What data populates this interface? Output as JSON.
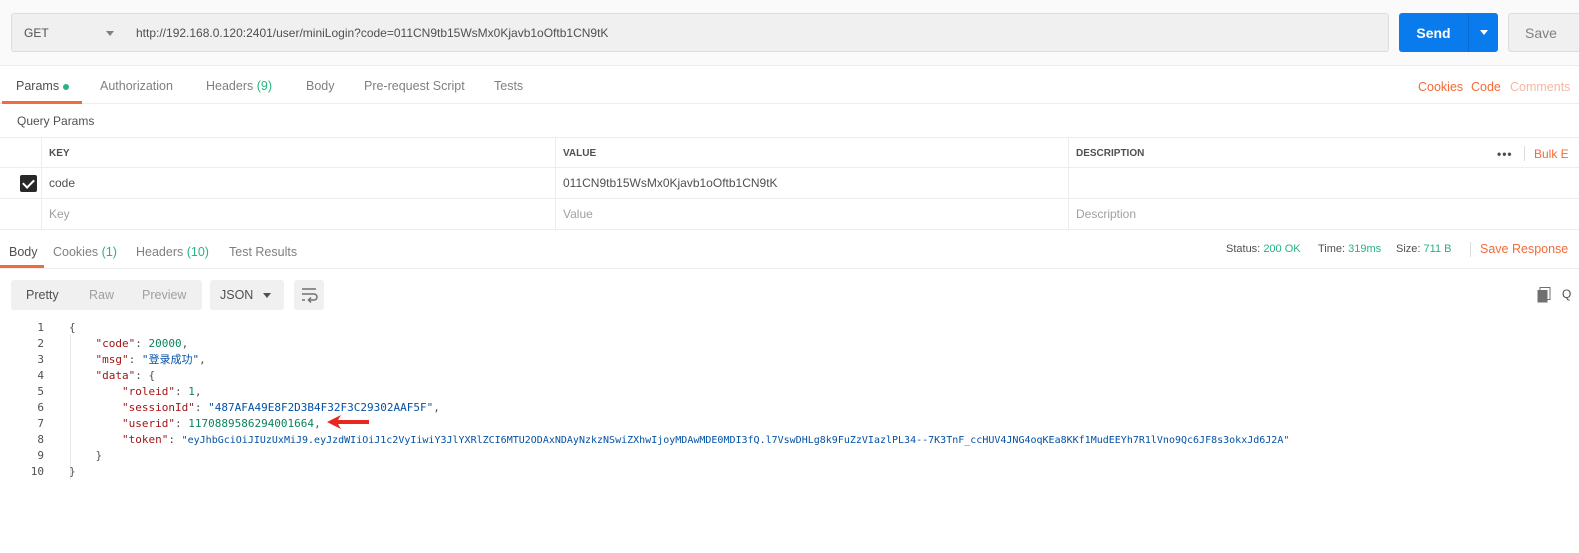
{
  "request": {
    "method": "GET",
    "url": "http://192.168.0.120:2401/user/miniLogin?code=011CN9tb15WsMx0Kjavb1oOftb1CN9tK",
    "send_label": "Send",
    "save_label": "Save"
  },
  "request_tabs": {
    "params": "Params",
    "authorization": "Authorization",
    "headers": "Headers",
    "headers_count": "(9)",
    "body": "Body",
    "prerequest": "Pre-request Script",
    "tests": "Tests"
  },
  "right_links": {
    "cookies": "Cookies",
    "code": "Code",
    "comments": "Comments"
  },
  "query_params": {
    "label": "Query Params",
    "headers": {
      "key": "KEY",
      "value": "VALUE",
      "description": "DESCRIPTION"
    },
    "rows": [
      {
        "key": "code",
        "value": "011CN9tb15WsMx0Kjavb1oOftb1CN9tK",
        "description": ""
      }
    ],
    "placeholders": {
      "key": "Key",
      "value": "Value",
      "description": "Description"
    },
    "bulk_edit": "Bulk E"
  },
  "response_tabs": {
    "body": "Body",
    "cookies": "Cookies",
    "cookies_count": "(1)",
    "headers": "Headers",
    "headers_count": "(10)",
    "test_results": "Test Results"
  },
  "response_status": {
    "status_label": "Status:",
    "status_value": "200 OK",
    "time_label": "Time:",
    "time_value": "319ms",
    "size_label": "Size:",
    "size_value": "711 B",
    "save_response": "Save Response"
  },
  "format": {
    "pretty": "Pretty",
    "raw": "Raw",
    "preview": "Preview",
    "language": "JSON"
  },
  "response_json": {
    "line_numbers": [
      "1",
      "2",
      "3",
      "4",
      "5",
      "6",
      "7",
      "8",
      "9",
      "10"
    ],
    "code_key": "\"code\"",
    "code_value": "20000",
    "msg_key": "\"msg\"",
    "msg_value": "\"登录成功\"",
    "data_key": "\"data\"",
    "roleid_key": "\"roleid\"",
    "roleid_value": "1",
    "sessionid_key": "\"sessionId\"",
    "sessionid_value": "\"487AFA49E8F2D3B4F32F3C29302AAF5F\"",
    "userid_key": "\"userid\"",
    "userid_value": "1170889586294001664",
    "token_key": "\"token\"",
    "token_value": "\"eyJhbGciOiJIUzUxMiJ9.eyJzdWIiOiJ1c2VyIiwiY3JlYXRlZCI6MTU2ODAxNDAyNzkzNSwiZXhwIjoyMDAwMDE0MDI3fQ.l7VswDHLg8k9FuZzVIazlPL34--7K3TnF_ccHUV4JNG4oqKEa8KKf1MudEEYh7R1lVno9Qc6JF8s3okxJd6J2A\""
  },
  "colors": {
    "accent": "#f26b3a",
    "send": "#097bed",
    "success": "#26b47f",
    "annotation_arrow": "#e8271e"
  }
}
